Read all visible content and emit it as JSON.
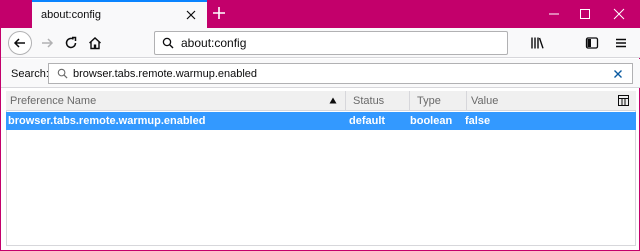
{
  "browser": {
    "tab_title": "about:config",
    "url": "about:config"
  },
  "colors": {
    "titlebar": "#c3006b",
    "selection": "#3399ff",
    "tab_accent": "#0a84ff"
  },
  "icons": {
    "tab_close": "close-icon",
    "new_tab": "plus-icon",
    "minimize": "minimize-icon",
    "maximize": "maximize-icon",
    "close": "close-icon",
    "back": "arrow-left-icon",
    "forward": "arrow-right-icon",
    "reload": "reload-icon",
    "home": "home-icon",
    "url_search": "search-icon",
    "library": "library-icon",
    "sidebar": "sidebar-icon",
    "menu": "hamburger-menu-icon",
    "search_filter": "search-icon",
    "search_clear": "close-icon",
    "sort": "sort-ascending-icon",
    "column_picker": "column-picker-icon"
  },
  "search": {
    "label": "Search:",
    "value": "browser.tabs.remote.warmup.enabled"
  },
  "table": {
    "columns": [
      "Preference Name",
      "Status",
      "Type",
      "Value"
    ],
    "rows": [
      {
        "name": "browser.tabs.remote.warmup.enabled",
        "status": "default",
        "type": "boolean",
        "value": "false"
      }
    ]
  }
}
